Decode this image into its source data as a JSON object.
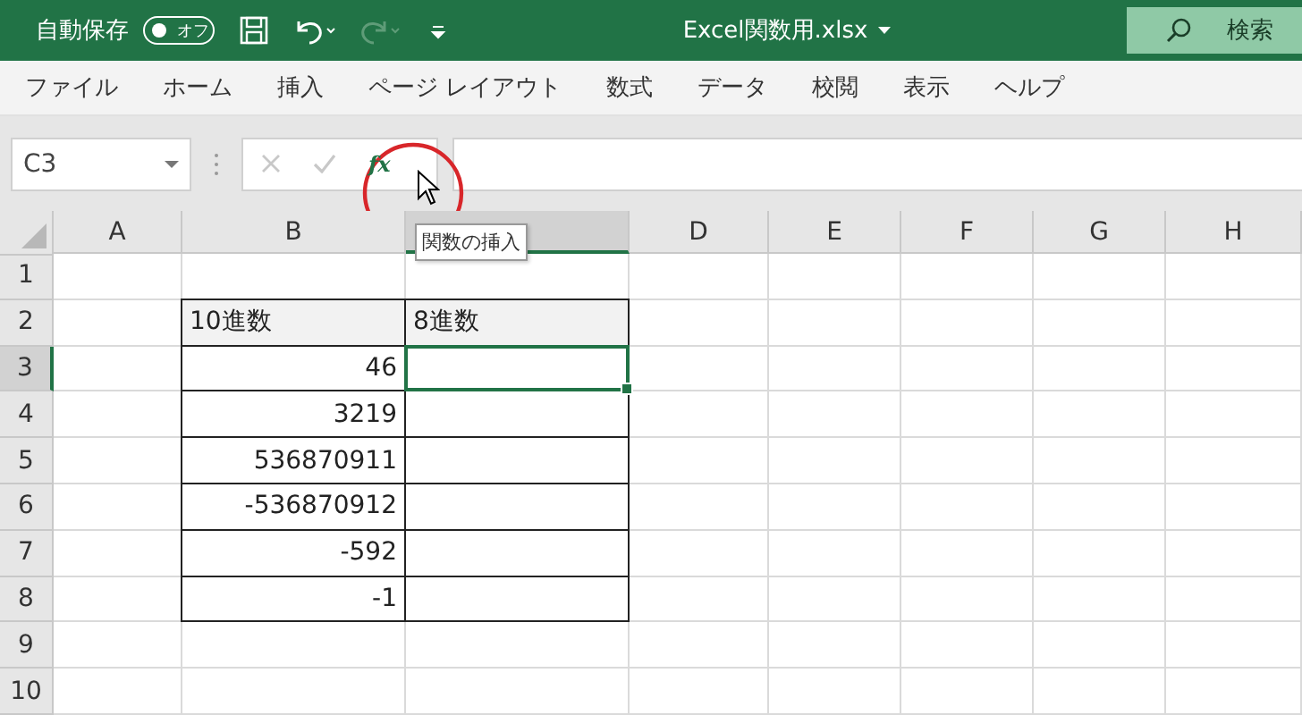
{
  "title_bar": {
    "autosave_label": "自動保存",
    "autosave_toggle": {
      "label": "オフ",
      "on": false
    },
    "file_name": "Excel関数用.xlsx",
    "search_label": "検索"
  },
  "menu": [
    "ファイル",
    "ホーム",
    "挿入",
    "ページ レイアウト",
    "数式",
    "データ",
    "校閲",
    "表示",
    "ヘルプ"
  ],
  "formula_bar": {
    "name_box": "C3",
    "function_button": "fx"
  },
  "tooltip": "関数の挿入",
  "columns": [
    {
      "label": "A",
      "selected": false
    },
    {
      "label": "B",
      "selected": false
    },
    {
      "selected": true
    },
    {
      "label": "D",
      "selected": false
    },
    {
      "label": "E",
      "selected": false
    },
    {
      "label": "F",
      "selected": false
    },
    {
      "label": "G",
      "selected": false
    },
    {
      "label": "H",
      "selected": false
    }
  ],
  "rows": [
    {
      "label": "1",
      "selected": false
    },
    {
      "label": "2",
      "selected": false,
      "cells": [
        {
          "kind": "header",
          "text": "10進数",
          "selected": false
        },
        {
          "kind": "header",
          "text": "8進数",
          "selected": false
        }
      ]
    },
    {
      "label": "3",
      "selected": true,
      "cells": [
        {
          "kind": "number",
          "text": "46",
          "selected": false
        },
        {
          "kind": "number",
          "selected": true
        }
      ]
    },
    {
      "label": "4",
      "selected": false,
      "cells": [
        {
          "kind": "number",
          "text": "3219",
          "selected": false
        },
        {
          "kind": "number",
          "selected": false
        }
      ]
    },
    {
      "label": "5",
      "selected": false,
      "cells": [
        {
          "kind": "number",
          "text": "536870911",
          "selected": false
        },
        {
          "kind": "number",
          "selected": false
        }
      ]
    },
    {
      "label": "6",
      "selected": false,
      "cells": [
        {
          "kind": "number",
          "text": "-536870912",
          "selected": false
        },
        {
          "kind": "number",
          "selected": false
        }
      ]
    },
    {
      "label": "7",
      "selected": false,
      "cells": [
        {
          "kind": "number",
          "text": "-592",
          "selected": false
        },
        {
          "kind": "number",
          "selected": false
        }
      ]
    },
    {
      "label": "8",
      "selected": false,
      "cells": [
        {
          "kind": "number",
          "text": "-1",
          "selected": false
        },
        {
          "kind": "number",
          "selected": false
        }
      ]
    },
    {
      "label": "9",
      "selected": false
    },
    {
      "label": "10",
      "selected": false
    }
  ]
}
